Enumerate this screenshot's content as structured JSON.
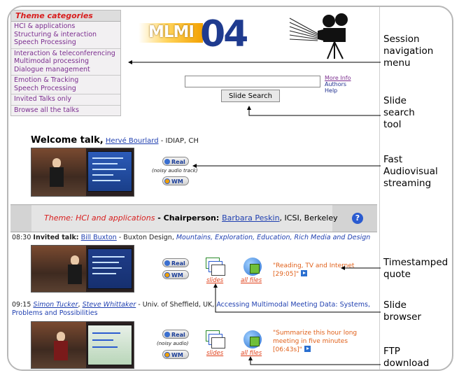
{
  "menu": {
    "header": "Theme categories",
    "groups": [
      [
        "HCI & applications",
        "Structuring & interaction",
        "Speech Processing"
      ],
      [
        "Interaction & teleconferencing",
        "Multimodal processing",
        "Dialogue management"
      ],
      [
        "Emotion & Tracking",
        "Speech Processing"
      ],
      [
        "Invited Talks only"
      ],
      [
        "Browse all the talks"
      ]
    ]
  },
  "logo": {
    "text": "MLMI",
    "year": "04"
  },
  "search": {
    "button": "Slide Search",
    "links": [
      "More Info",
      "Authors",
      "Help"
    ]
  },
  "welcome": {
    "title": "Welcome talk,",
    "speaker": "Hervé Bourlard",
    "affiliation": " - IDIAP, CH",
    "real": "Real",
    "wm": "WM",
    "note": "(noisy audio track)"
  },
  "theme": {
    "label": "Theme: HCI and applications",
    "chair_prefix": " - Chairperson: ",
    "chair": "Barbara Peskin",
    "chair_aff": ", ICSI, Berkeley",
    "help": "?"
  },
  "talks": [
    {
      "time": "08:30",
      "kind": "Invited talk:",
      "speakers": [
        "Bill Buxton"
      ],
      "affiliation": " - Buxton Design, ",
      "title": "Mountains, Exploration, Education, Rich Media and Design",
      "real": "Real",
      "wm": "WM",
      "slides": "slides",
      "files": "all files",
      "quote1": "\"Reading, TV and Internet",
      "quote2": "[29:05]\""
    },
    {
      "time": "09:15",
      "speakers": [
        "Simon Tucker",
        "Steve Whittaker"
      ],
      "affiliation": " - Univ. of Sheffield, UK, ",
      "title1": "Accessing Multimodal Meeting Data: Systems,",
      "title2": "Problems and Possibilities",
      "real": "Real",
      "wm": "WM",
      "note": "(noisy audio)",
      "slides": "slides",
      "files": "all files",
      "quote1": "\"Summarize this hour long",
      "quote2": "meeting in five minutes",
      "quote3": "[06:43s]\""
    }
  ],
  "annotations": {
    "nav": [
      "Session",
      "navigation",
      "menu"
    ],
    "search": [
      "Slide",
      "search",
      "tool"
    ],
    "stream": [
      "Fast",
      "Audiovisual",
      "streaming"
    ],
    "quote": [
      "Timestamped",
      "quote"
    ],
    "browser": [
      "Slide",
      "browser"
    ],
    "ftp": [
      "FTP",
      "download"
    ]
  }
}
